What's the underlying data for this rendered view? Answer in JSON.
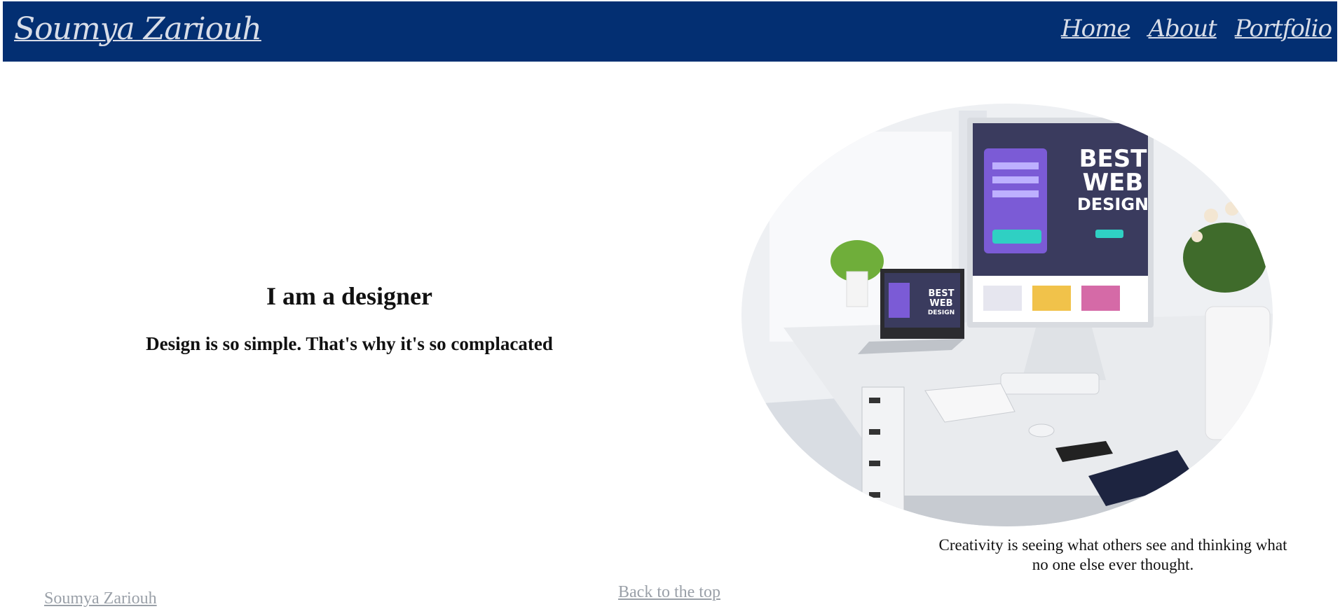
{
  "nav": {
    "brand": "Soumya Zariouh",
    "links": [
      "Home",
      "About",
      "Portfolio"
    ]
  },
  "hero": {
    "heading": "I am a designer",
    "subheading": "Design is so simple. That's why it's so complacated"
  },
  "image": {
    "monitor_text": [
      "BEST",
      "WEB",
      "DESIGN"
    ],
    "laptop_text": [
      "BEST",
      "WEB",
      "DESIGN"
    ]
  },
  "quote": "Creativity is seeing what others see and thinking what no one else ever thought.",
  "footer": {
    "brand": "Soumya Zariouh",
    "back_to_top": "Back to the top"
  },
  "colors": {
    "navbar": "#032f72",
    "nav_text": "#d8dde8",
    "link_muted": "#9aa0a8"
  }
}
